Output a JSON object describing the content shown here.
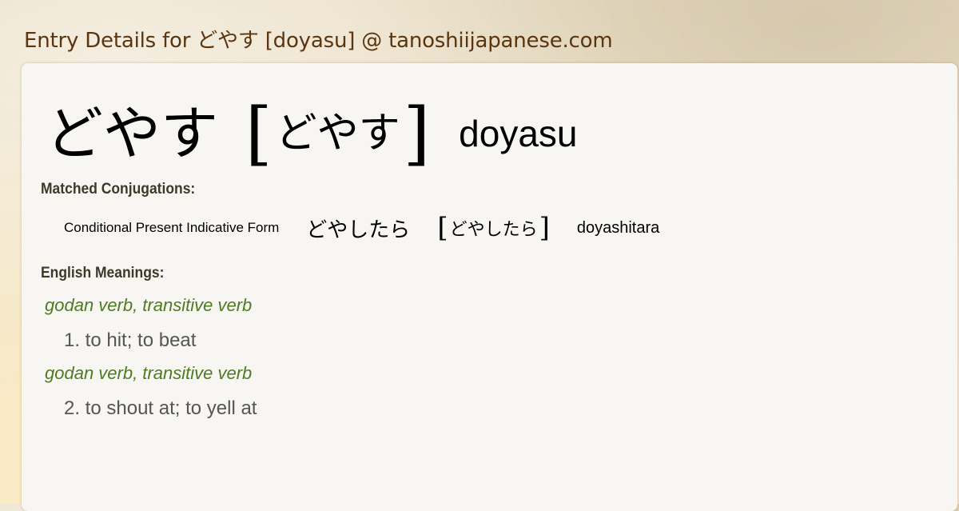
{
  "page": {
    "title": "Entry Details for どやす [doyasu] @ tanoshiijapanese.com"
  },
  "entry": {
    "kanji": "どやす",
    "open_bracket": "[",
    "kana": "どやす",
    "close_bracket": "]",
    "romaji": "doyasu"
  },
  "conjugations": {
    "label": "Matched Conjugations:",
    "items": [
      {
        "form": "Conditional Present Indicative Form",
        "kanji": "どやしたら",
        "kana": "どやしたら",
        "romaji": "doyashitara"
      }
    ]
  },
  "meanings": {
    "label": "English Meanings:",
    "items": [
      {
        "pos": "godan verb, transitive verb",
        "gloss": "1. to hit; to beat"
      },
      {
        "pos": "godan verb, transitive verb",
        "gloss": "2. to shout at; to yell at"
      }
    ]
  },
  "colors": {
    "title": "#5a3510",
    "part_of_speech": "#4e7a22",
    "gloss": "#555555",
    "card": "#f7f6f2",
    "background": "#efe4cc"
  }
}
